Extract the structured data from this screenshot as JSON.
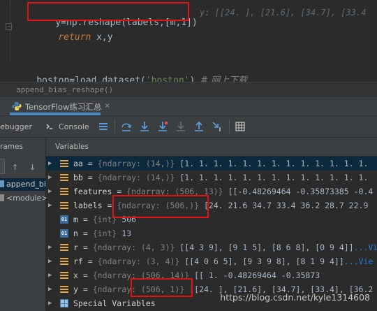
{
  "editor": {
    "line_reshape": {
      "code": "y=np.reshape(labels,[m,1])",
      "hint": "y: [[24. ], [21.6], [34.7], [33.4"
    },
    "line_return": {
      "keyword": "return",
      "rest": " x,y"
    },
    "line_load": {
      "var": "boston",
      "eq": "=",
      "fn": "load_dataset",
      "arg": "'boston'",
      "comment": "# 网上下载"
    }
  },
  "breadcrumb": "append_bias_reshape()",
  "run_tab": {
    "label": "TensorFlow练习汇总",
    "close_icon": "close-icon"
  },
  "toolbar": {
    "debugger_label": "ebugger",
    "console_label": "Console"
  },
  "frames": {
    "header": "rames",
    "items": [
      "append_bi",
      "<module>"
    ]
  },
  "variables": {
    "header": "Variables",
    "rows": [
      {
        "name": "aa",
        "type": "{ndarray: (14,)}",
        "value": "[1. 1. 1. 1. 1. 1. 1. 1. 1. 1. 1. 1. 1.",
        "view": "",
        "icon": "bars-icon",
        "expandable": true
      },
      {
        "name": "bb",
        "type": "{ndarray: (14,)}",
        "value": "[1. 1. 1. 1. 1. 1. 1. 1. 1. 1. 1. 1. 1.",
        "view": "",
        "icon": "bars-icon",
        "expandable": true
      },
      {
        "name": "features",
        "type": "{ndarray: (506, 13)}",
        "value": "[[-0.48269464 -0.35873385 -0.4",
        "view": "",
        "icon": "bars-icon",
        "expandable": true
      },
      {
        "name": "labels",
        "type": "{ndarray: (506,)}",
        "value": "[24.  21.6 34.7 33.4 36.2 28.7 22.9",
        "view": "",
        "icon": "bars-icon",
        "expandable": true
      },
      {
        "name": "m",
        "type": "{int}",
        "value": "506",
        "view": "",
        "icon": "int-icon",
        "expandable": false
      },
      {
        "name": "n",
        "type": "{int}",
        "value": "13",
        "view": "",
        "icon": "int-icon",
        "expandable": false
      },
      {
        "name": "r",
        "type": "{ndarray: (4, 3)}",
        "value": "[[4 3 9], [9 1 5], [8 6 8], [0 9 4]]",
        "view": "...Vi",
        "icon": "bars-icon",
        "expandable": true
      },
      {
        "name": "rf",
        "type": "{ndarray: (3, 4)}",
        "value": "[[4 0 6 5], [9 3 9 8], [8 1 9 4]]",
        "view": "...Vie",
        "icon": "bars-icon",
        "expandable": true
      },
      {
        "name": "x",
        "type": "{ndarray: (506, 14)}",
        "value": "[[ 1.          -0.48269464 -0.35873",
        "view": "",
        "icon": "bars-icon",
        "expandable": true
      },
      {
        "name": "y",
        "type": "{ndarray: (506, 1)}",
        "value": "[[24. ], [21.6], [34.7], [33.4], [36.2",
        "view": "",
        "icon": "bars-icon",
        "expandable": true
      },
      {
        "name": "Special Variables",
        "type": "",
        "value": "",
        "view": "",
        "icon": "grid-icon",
        "expandable": true
      }
    ]
  },
  "watermark": "https://blog.csdn.net/kyle1314608",
  "colors": {
    "accent": "#4a88c7",
    "highlight_box": "#e01414",
    "selection": "#0d293e"
  }
}
